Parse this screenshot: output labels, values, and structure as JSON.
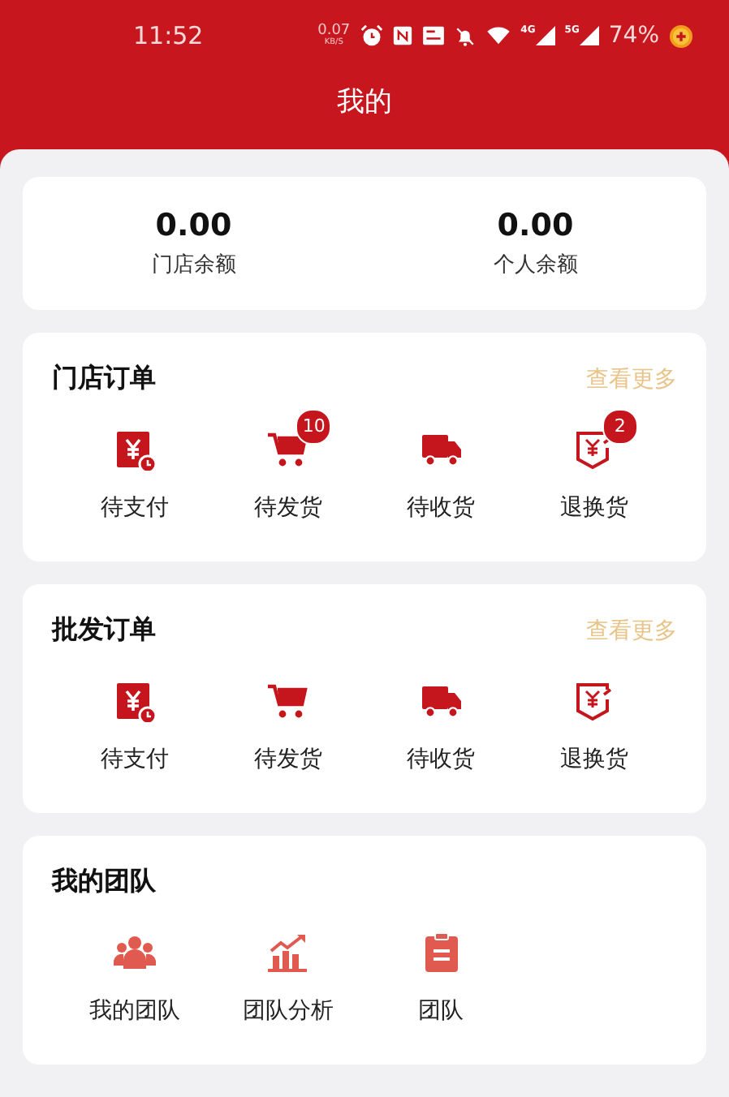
{
  "status_bar": {
    "time": "11:52",
    "speed": "0.07",
    "speed_unit": "KB/S",
    "net_labels": [
      "4G",
      "5G"
    ],
    "battery": "74%"
  },
  "title": "我的",
  "balances": [
    {
      "amount": "0.00",
      "label": "门店余额"
    },
    {
      "amount": "0.00",
      "label": "个人余额"
    }
  ],
  "sections": [
    {
      "title": "门店订单",
      "more": "查看更多",
      "items": [
        {
          "kind": "pay",
          "label": "待支付"
        },
        {
          "kind": "cart",
          "label": "待发货",
          "badge": "10"
        },
        {
          "kind": "truck",
          "label": "待收货"
        },
        {
          "kind": "refund",
          "label": "退换货",
          "badge": "2"
        }
      ]
    },
    {
      "title": "批发订单",
      "more": "查看更多",
      "items": [
        {
          "kind": "pay",
          "label": "待支付"
        },
        {
          "kind": "cart",
          "label": "待发货"
        },
        {
          "kind": "truck",
          "label": "待收货"
        },
        {
          "kind": "refund",
          "label": "退换货"
        }
      ]
    },
    {
      "title": "我的团队",
      "items": [
        {
          "kind": "team",
          "label": "我的团队"
        },
        {
          "kind": "chart",
          "label": "团队分析"
        },
        {
          "kind": "clipboard",
          "label": "团队"
        }
      ]
    }
  ]
}
